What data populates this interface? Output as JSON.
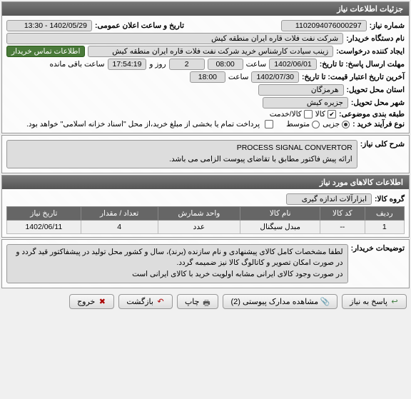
{
  "panel1": {
    "title": "جزئیات اطلاعات نیاز",
    "need_number_label": "شماره نیاز:",
    "need_number": "1102094076000297",
    "announce_label": "تاریخ و ساعت اعلان عمومی:",
    "announce_value": "1402/05/29 - 13:30",
    "buyer_label": "نام دستگاه خریدار:",
    "buyer_value": "شرکت نفت فلات قاره ایران منطقه کیش",
    "creator_label": "ایجاد کننده درخواست:",
    "creator_value": "زینب سیادت کارشناس خرید  شرکت نفت فلات قاره ایران منطقه کیش",
    "contact_badge": "اطلاعات تماس خریدار",
    "deadline_label": "مهلت ارسال پاسخ: تا تاریخ:",
    "deadline_date": "1402/06/01",
    "time_label": "ساعت",
    "deadline_time": "08:00",
    "days_value": "2",
    "days_and": "روز و",
    "remaining_time": "17:54:19",
    "remaining_label": "ساعت باقی مانده",
    "valid_label": "آخرین تاریخ اعتبار قیمت: تا تاریخ:",
    "valid_date": "1402/07/30",
    "valid_time": "18:00",
    "province_label": "استان محل تحویل:",
    "province_value": "هرمزگان",
    "city_label": "شهر محل تحویل:",
    "city_value": "جزیره کیش",
    "category_label": "طبقه بندی موضوعی:",
    "cat_goods": "کالا",
    "cat_service": "کالا/خدمت",
    "process_label": "نوع فرآیند خرید :",
    "proc_small": "جزیی",
    "proc_medium": "متوسط",
    "payment_note": "پرداخت تمام یا بخشی از مبلغ خرید،از محل \"اسناد خزانه اسلامی\" خواهد بود."
  },
  "panel2": {
    "desc_label": "شرح کلی نیاز:",
    "desc_line1": "PROCESS SIGNAL CONVERTOR",
    "desc_line2": "ارائه پیش فاکتور مطابق با تقاضای پیوست الزامی می باشد."
  },
  "panel3": {
    "title": "اطلاعات کالاهای مورد نیاز",
    "group_label": "گروه کالا:",
    "group_value": "ابزارآلات اندازه گیری",
    "cols": {
      "row": "ردیف",
      "code": "کد کالا",
      "name": "نام کالا",
      "unit": "واحد شمارش",
      "qty": "تعداد / مقدار",
      "date": "تاریخ نیاز"
    },
    "rows": [
      {
        "row": "1",
        "code": "--",
        "name": "مبدل سیگنال",
        "unit": "عدد",
        "qty": "4",
        "date": "1402/06/11"
      }
    ]
  },
  "panel4": {
    "label": "توضیحات خریدار:",
    "line1": "لطفا مشخصات کامل کالای پیشنهادی و نام سازنده (برند)،  سال و کشور محل تولید در پیشفاکتور قید گردد و در صورت امکان تصویر و کاتالوگ کالا نیز ضمیمه گردد.",
    "line2": "در صورت وجود کالای ایرانی مشابه اولویت خرید با کالای ایرانی است"
  },
  "buttons": {
    "reply": "پاسخ به نیاز",
    "attach": "مشاهده مدارک پیوستی (2)",
    "print": "چاپ",
    "back": "بازگشت",
    "exit": "خروج"
  }
}
